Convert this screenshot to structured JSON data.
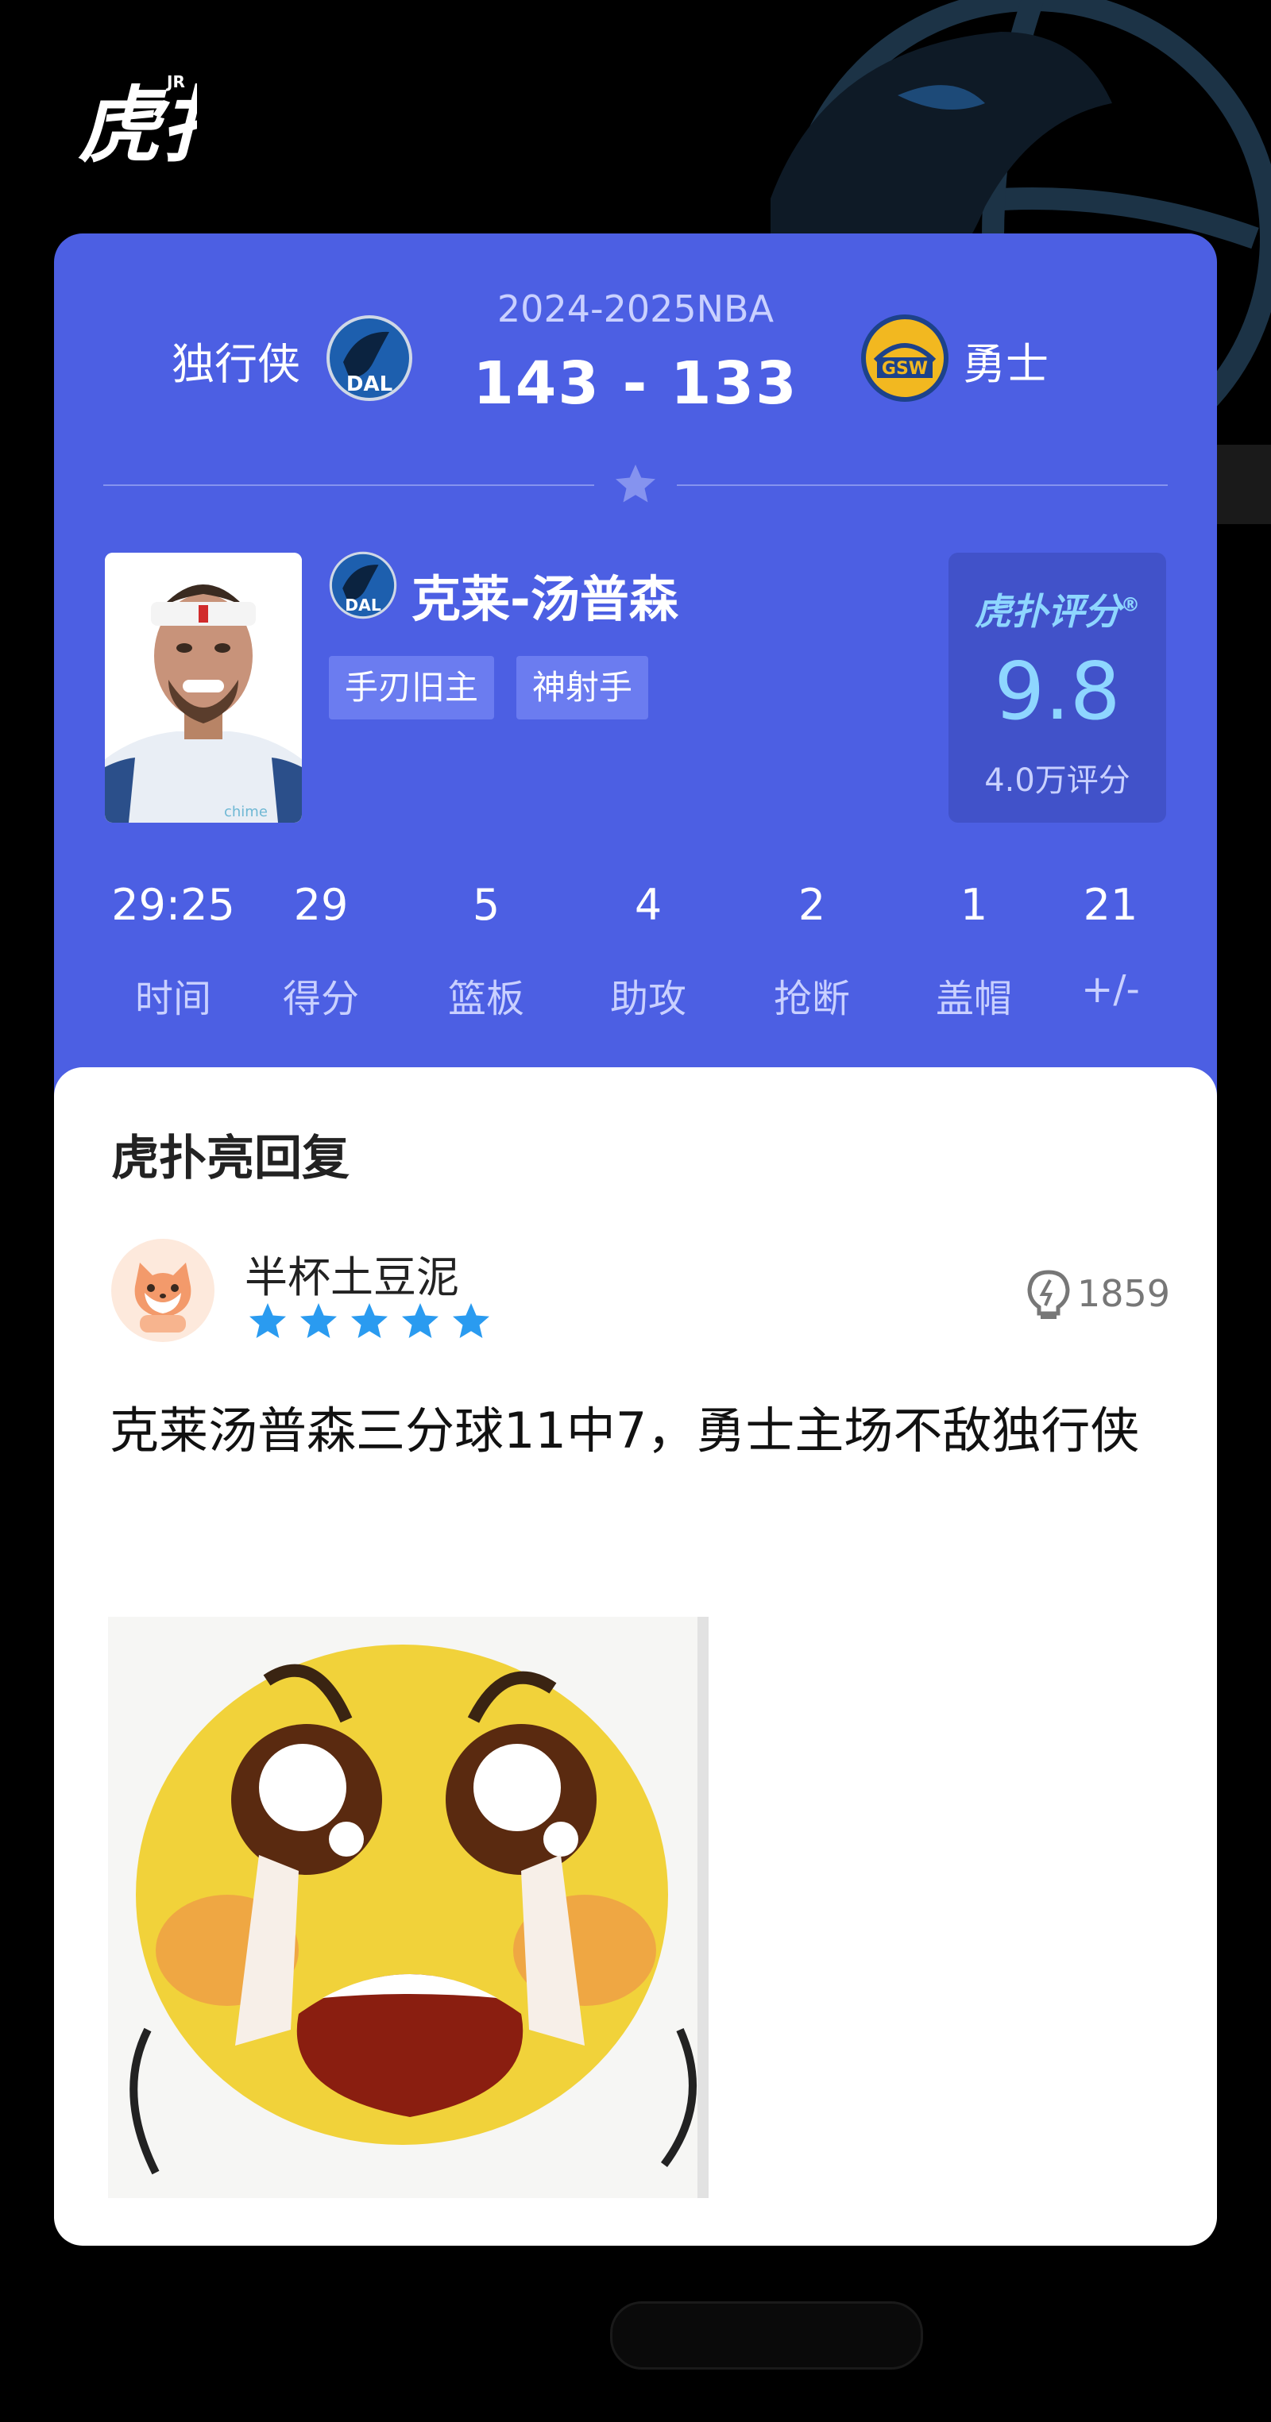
{
  "app": {
    "logo_text": "虎扑",
    "logo_sup": "JR"
  },
  "match": {
    "season": "2024-2025NBA",
    "home_name": "独行侠",
    "home_logo": "DAL",
    "away_name": "勇士",
    "away_logo": "GSW",
    "score": "143 - 133"
  },
  "player": {
    "name": "克莱-汤普森",
    "team_logo": "DAL",
    "tags": [
      "手刃旧主",
      "神射手"
    ],
    "jersey_sponsor": "chime"
  },
  "rating": {
    "brand": "虎扑评分",
    "registered": "®",
    "value": "9.8",
    "count": "4.0万评分"
  },
  "stats": [
    {
      "value": "29:25",
      "label": "时间"
    },
    {
      "value": "29",
      "label": "得分"
    },
    {
      "value": "5",
      "label": "篮板"
    },
    {
      "value": "4",
      "label": "助攻"
    },
    {
      "value": "2",
      "label": "抢断"
    },
    {
      "value": "1",
      "label": "盖帽"
    },
    {
      "value": "21",
      "label": "+/-"
    }
  ],
  "reply": {
    "section_title": "虎扑亮回复",
    "username": "半杯土豆泥",
    "stars": 5,
    "likes": "1859",
    "text": "克莱汤普森三分球11中7，勇士主场不敌独行侠"
  },
  "colors": {
    "card_blue": "#4c5fe3",
    "rating_accent": "#8ed6ff",
    "star_blue": "#2a9bf0"
  },
  "icons": {
    "logo": "hupu-logo",
    "rating_divider": "star-icon",
    "likes": "lightbulb-icon",
    "stars": "star-icon"
  }
}
